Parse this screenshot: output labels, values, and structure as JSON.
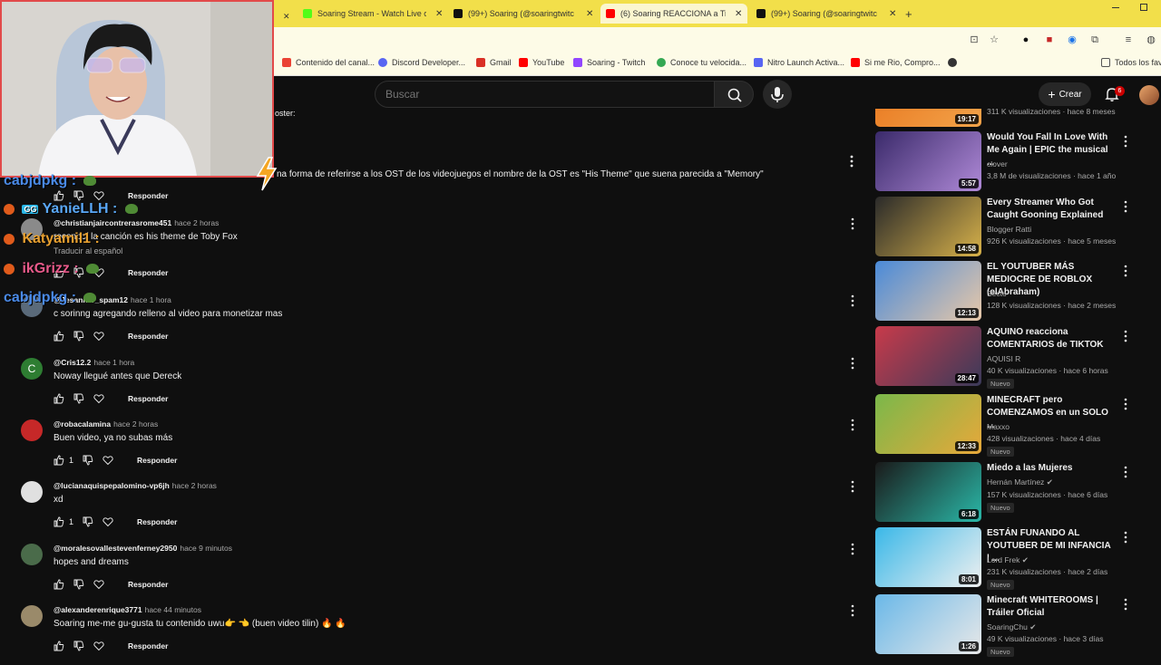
{
  "browser": {
    "tabs": [
      {
        "title": "Soaring Stream - Watch Live o",
        "icon_color": "#53fc18",
        "icon": "kick-icon"
      },
      {
        "title": "(99+) Soaring (@soaringtwitc",
        "icon_color": "#111111",
        "icon": "tiktok-icon"
      },
      {
        "title": "(6) Soaring REACCIONA a TikT",
        "icon_color": "#ff0000",
        "icon": "youtube-icon"
      },
      {
        "title": "(99+) Soaring (@soaringtwitc",
        "icon_color": "#111111",
        "icon": "tiktok-icon"
      }
    ],
    "new_tab": "+",
    "close": "✕",
    "bookmarks": [
      {
        "label": "Contenido del canal...",
        "color": "#ea4335"
      },
      {
        "label": "Discord Developer...",
        "color": "#5865f2"
      },
      {
        "label": "Gmail",
        "color": "#d93025"
      },
      {
        "label": "YouTube",
        "color": "#ff0000"
      },
      {
        "label": "Soaring - Twitch",
        "color": "#9146ff"
      },
      {
        "label": "Conoce tu velocida...",
        "color": "#34a853"
      },
      {
        "label": "Nitro Launch Activa...",
        "color": "#5865f2"
      },
      {
        "label": "Si me Rio, Compro...",
        "color": "#ff0000"
      },
      {
        "label": "",
        "color": "#333333"
      }
    ],
    "all_bookmarks": "Todos los fav"
  },
  "youtube": {
    "search_placeholder": "Buscar",
    "create_label": "Crear",
    "notif_count": "6"
  },
  "comments_partial": {
    "top_fragment": "oster:",
    "long_fragment": "na forma de referirse a los OST de los videojuegos el nombre de la OST es \"His Theme\" que suena parecida a \"Memory\""
  },
  "comments": [
    {
      "user": "@christianjaircontrerasrome451",
      "time": "hace 2 horas",
      "text": "reconocí la canción es his theme de Toby Fox",
      "translate": "Traducir al español",
      "likes": "",
      "reply": "Responder",
      "avatar_color": "#8a8a8a"
    },
    {
      "user": "@Jesanner_spam12",
      "time": "hace 1 hora",
      "text": "c sorinng agregando relleno al video para monetizar mas",
      "translate": "",
      "likes": "",
      "reply": "Responder",
      "avatar_color": "#5a6a7a"
    },
    {
      "user": "@Cris12.2",
      "time": "hace 1 hora",
      "text": "Noway llegué antes que Dereck",
      "translate": "",
      "likes": "",
      "reply": "Responder",
      "avatar_color": "#2e7d32",
      "initial": "C"
    },
    {
      "user": "@robacalamina",
      "time": "hace 2 horas",
      "text": "Buen video, ya no subas más",
      "translate": "",
      "likes": "1",
      "reply": "Responder",
      "avatar_color": "#c62828"
    },
    {
      "user": "@lucianaquispepalomino-vp6jh",
      "time": "hace 2 horas",
      "text": "xd",
      "translate": "",
      "likes": "1",
      "reply": "Responder",
      "avatar_color": "#e0e0e0"
    },
    {
      "user": "@moralesovallestevenferney2950",
      "time": "hace 9 minutos",
      "text": "hopes and dreams",
      "translate": "",
      "likes": "",
      "reply": "Responder",
      "avatar_color": "#4a6b4a"
    },
    {
      "user": "@alexanderenrique3771",
      "time": "hace 44 minutos",
      "text": "Soaring me-me gu-gusta tu contenido uwu👉 👈 (buen video tilin) 🔥 🔥",
      "translate": "",
      "likes": "",
      "reply": "Responder",
      "avatar_color": "#9a8a6a"
    }
  ],
  "first_actions": {
    "reply": "Responder"
  },
  "sidebar": [
    {
      "title": "",
      "channel": "",
      "meta": "311 K visualizaciones · hace 8 meses",
      "duration": "19:17",
      "new": "",
      "verified": false,
      "thumb": [
        "#e8741c",
        "#f2a34a"
      ]
    },
    {
      "title": "Would You Fall In Love With Me Again | EPIC the musical ...",
      "channel": "clover",
      "meta": "3,8 M de visualizaciones · hace 1 año",
      "duration": "5:57",
      "new": "",
      "verified": false,
      "thumb": [
        "#3a2a6a",
        "#b08ad8"
      ]
    },
    {
      "title": "Every Streamer Who Got Caught Gooning Explained",
      "channel": "Blogger Ratti",
      "meta": "926 K visualizaciones · hace 5 meses",
      "duration": "14:58",
      "new": "",
      "verified": false,
      "thumb": [
        "#2a2a2a",
        "#d8b24a"
      ]
    },
    {
      "title": "EL YOUTUBER MÁS MEDIOCRE DE ROBLOX (elAbraham)",
      "channel": "Secto",
      "meta": "128 K visualizaciones · hace 2 meses",
      "duration": "12:13",
      "new": "",
      "verified": false,
      "thumb": [
        "#4a8ad8",
        "#e8c8a8"
      ]
    },
    {
      "title": "AQUINO reacciona COMENTARIOS de TIKTOK",
      "channel": "AQUISI R",
      "meta": "40 K visualizaciones · hace 6 horas",
      "duration": "28:47",
      "new": "Nuevo",
      "verified": false,
      "thumb": [
        "#c83a4a",
        "#3a3a5a"
      ]
    },
    {
      "title": "MINECRAFT pero COMENZAMOS en un SOLO ...",
      "channel": "Maxxo",
      "meta": "428 visualizaciones · hace 4 días",
      "duration": "12:33",
      "new": "Nuevo",
      "verified": false,
      "thumb": [
        "#7ab84a",
        "#e8a83a"
      ]
    },
    {
      "title": "Miedo a las Mujeres",
      "channel": "Hernán Martínez",
      "meta": "157 K visualizaciones · hace 6 días",
      "duration": "6:18",
      "new": "Nuevo",
      "verified": true,
      "thumb": [
        "#1a1a1a",
        "#2ab8a8"
      ]
    },
    {
      "title": "ESTÁN FUNANDO AL YOUTUBER DE MI INFANCIA | ...",
      "channel": "Lord Frek",
      "meta": "231 K visualizaciones · hace 2 días",
      "duration": "8:01",
      "new": "Nuevo",
      "verified": true,
      "thumb": [
        "#3ab8e8",
        "#f0f0f0"
      ]
    },
    {
      "title": "Minecraft WHITEROOMS | Tráiler Oficial",
      "channel": "SoaringChu",
      "meta": "49 K visualizaciones · hace 3 días",
      "duration": "1:26",
      "new": "Nuevo",
      "verified": true,
      "thumb": [
        "#6ab8e8",
        "#e8e8e8"
      ]
    }
  ],
  "stream_chat": [
    {
      "user": "cabjdpkg",
      "suffix": ":",
      "color": "#4a8ae8",
      "icon": false,
      "badge": ""
    },
    {
      "user": "YanieLLH",
      "suffix": ":",
      "color": "#5aa8f8",
      "icon": true,
      "badge": "GG"
    },
    {
      "user": "Katyamil1",
      "suffix": ":",
      "color": "#e8a030",
      "icon": true,
      "badge": ""
    },
    {
      "user": "ikGrizz",
      "suffix": ":",
      "color": "#e85a8a",
      "icon": true,
      "badge": ""
    },
    {
      "user": "cabjdpkg",
      "suffix": ":",
      "color": "#4a8ae8",
      "icon": false,
      "badge": ""
    }
  ]
}
